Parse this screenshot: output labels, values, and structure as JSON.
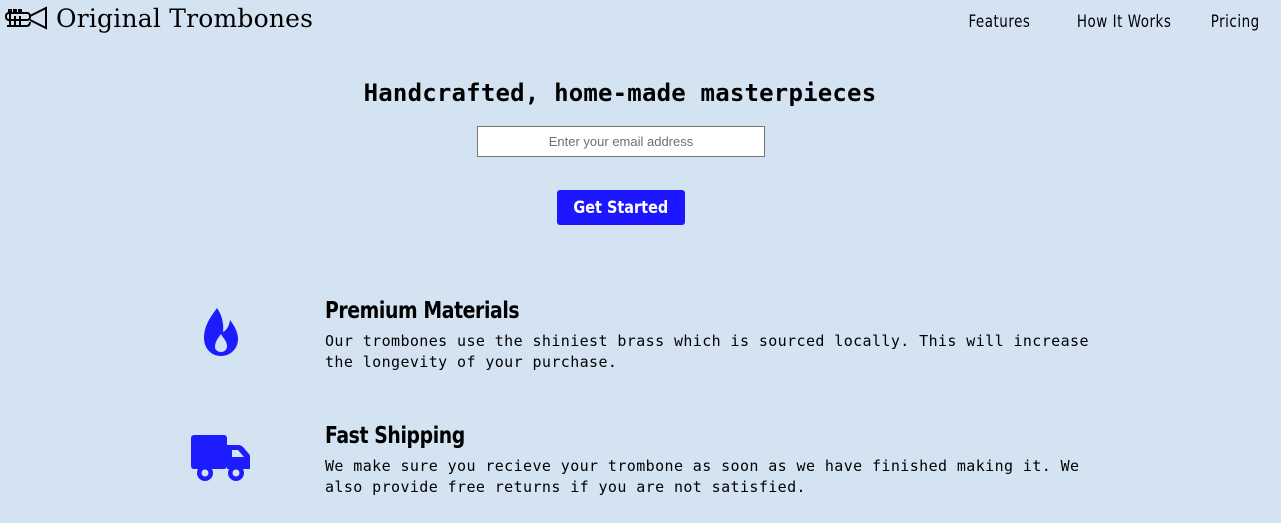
{
  "header": {
    "brand": "Original Trombones",
    "logo_icon": "trombone-icon",
    "nav": [
      {
        "label": "Features"
      },
      {
        "label": "How It Works"
      },
      {
        "label": "Pricing"
      }
    ]
  },
  "hero": {
    "title": "Handcrafted, home-made masterpieces",
    "email_placeholder": "Enter your email address",
    "cta_label": "Get Started"
  },
  "features": [
    {
      "icon": "flame-icon",
      "title": "Premium Materials",
      "description": "Our trombones use the shiniest brass which is sourced locally. This will increase the longevity of your purchase."
    },
    {
      "icon": "truck-icon",
      "title": "Fast Shipping",
      "description": "We make sure you recieve your trombone as soon as we have finished making it. We also provide free returns if you are not satisfied."
    }
  ],
  "colors": {
    "background": "#d3e3f2",
    "accent": "#1c17ff",
    "text": "#000000"
  }
}
